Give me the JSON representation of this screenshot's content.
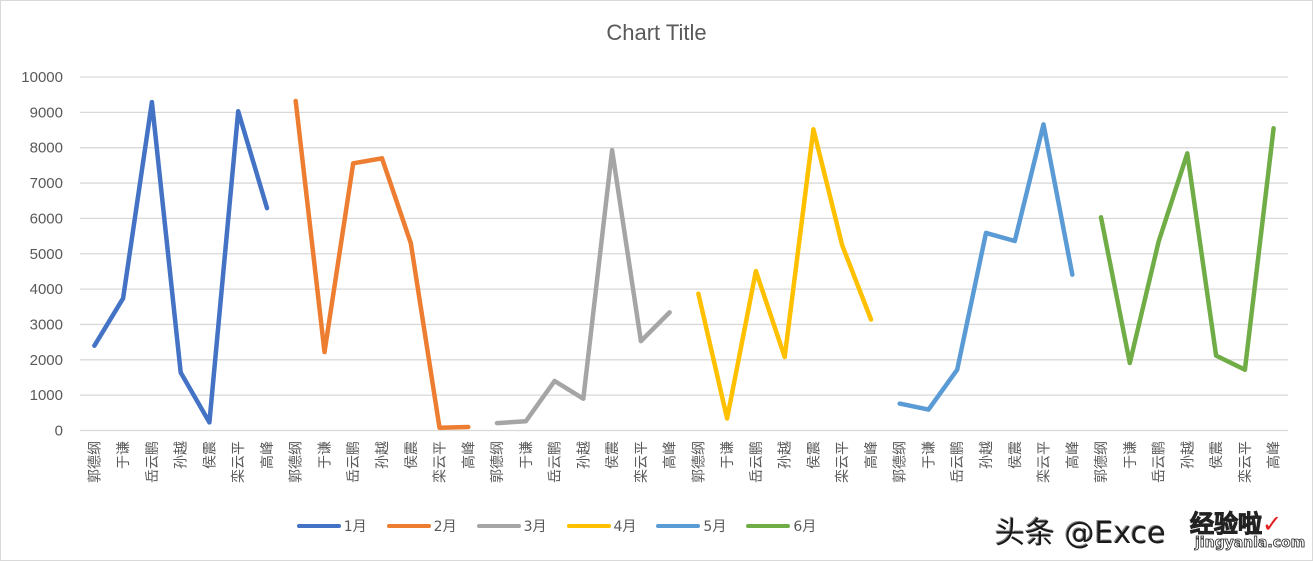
{
  "chart_data": {
    "type": "line",
    "title": "Chart Title",
    "xlabel": "",
    "ylabel": "",
    "ylim": [
      0,
      10000
    ],
    "yticks": [
      "0",
      "1000",
      "2000",
      "3000",
      "4000",
      "5000",
      "6000",
      "7000",
      "8000",
      "9000",
      "10000"
    ],
    "grid": true,
    "legend_position": "bottom",
    "names": [
      "郭德纲",
      "于谦",
      "岳云鹏",
      "孙越",
      "侯震",
      "栾云平",
      "高峰"
    ],
    "categories": [
      "郭德纲",
      "于谦",
      "岳云鹏",
      "孙越",
      "侯震",
      "栾云平",
      "高峰",
      "郭德纲",
      "于谦",
      "岳云鹏",
      "孙越",
      "侯震",
      "栾云平",
      "高峰",
      "郭德纲",
      "于谦",
      "岳云鹏",
      "孙越",
      "侯震",
      "栾云平",
      "高峰",
      "郭德纲",
      "于谦",
      "岳云鹏",
      "孙越",
      "侯震",
      "栾云平",
      "高峰",
      "郭德纲",
      "于谦",
      "岳云鹏",
      "孙越",
      "侯震",
      "栾云平",
      "高峰",
      "郭德纲",
      "于谦",
      "岳云鹏",
      "孙越",
      "侯震",
      "栾云平",
      "高峰"
    ],
    "series": [
      {
        "name": "1月",
        "color": "#4472c4",
        "start_index": 0,
        "values": [
          2400,
          3740,
          9290,
          1640,
          230,
          9030,
          6290
        ]
      },
      {
        "name": "2月",
        "color": "#ed7d31",
        "start_index": 7,
        "values": [
          9320,
          2220,
          7560,
          7700,
          5300,
          80,
          100
        ]
      },
      {
        "name": "3月",
        "color": "#a5a5a5",
        "start_index": 14,
        "values": [
          210,
          260,
          1400,
          900,
          7930,
          2530,
          3340
        ]
      },
      {
        "name": "4月",
        "color": "#ffc000",
        "start_index": 21,
        "values": [
          3870,
          340,
          4510,
          2080,
          8520,
          5240,
          3140
        ]
      },
      {
        "name": "5月",
        "color": "#5b9bd5",
        "start_index": 28,
        "values": [
          760,
          590,
          1720,
          5590,
          5360,
          8660,
          4410
        ]
      },
      {
        "name": "6月",
        "color": "#70ad47",
        "start_index": 35,
        "values": [
          6030,
          1910,
          5340,
          7840,
          2120,
          1720,
          8550
        ]
      }
    ]
  },
  "watermark": {
    "text": "头条 @Exce",
    "site_name": "经验啦",
    "check": "✓",
    "url": "jingyanla.com"
  }
}
